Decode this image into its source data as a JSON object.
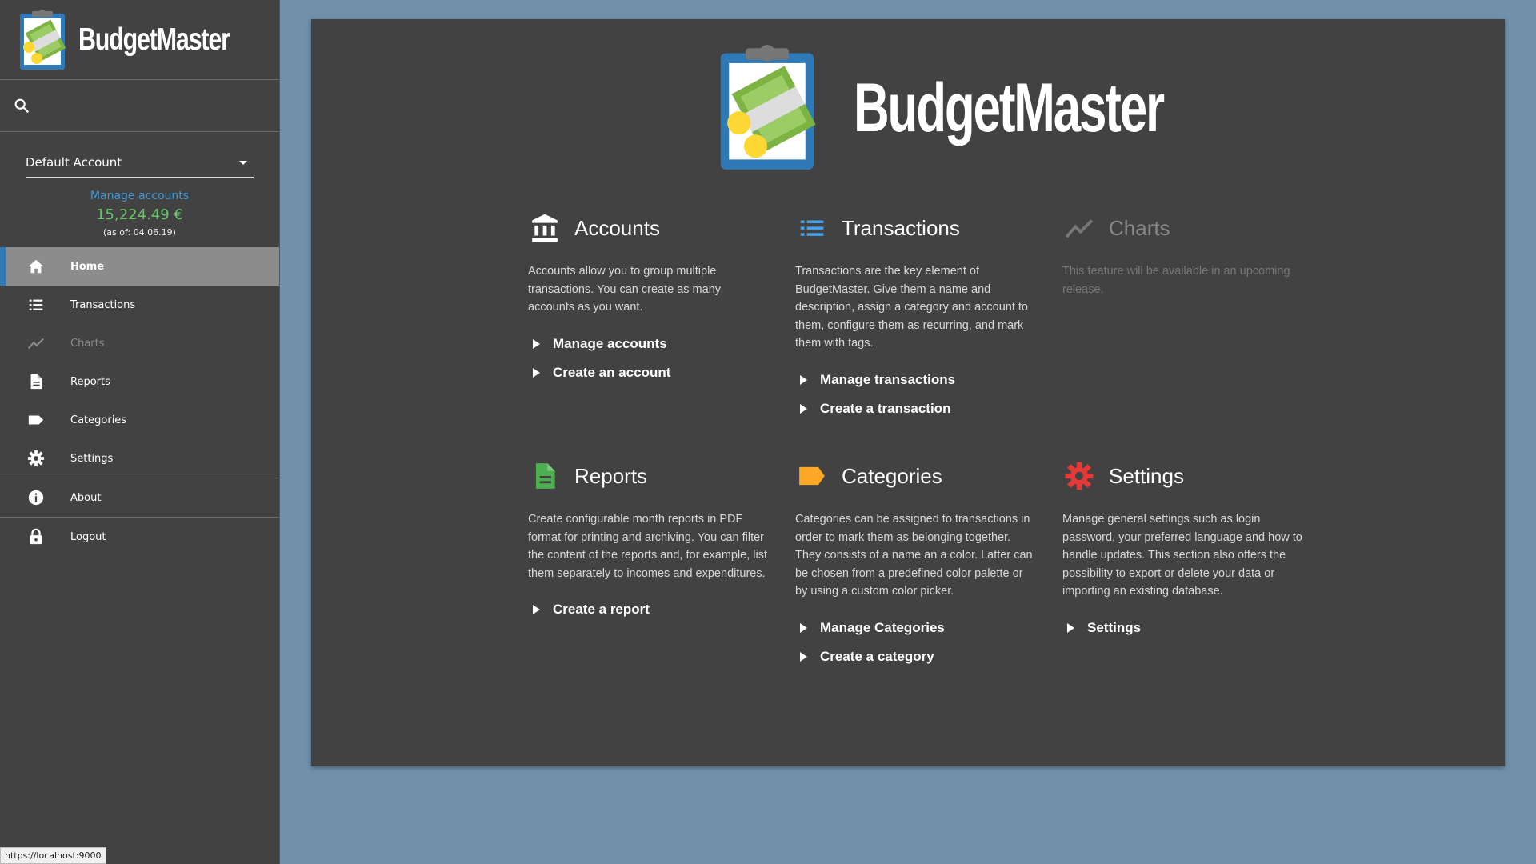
{
  "app": {
    "name": "BudgetMaster"
  },
  "account": {
    "selected": "Default Account",
    "manage_label": "Manage accounts",
    "balance": "15,224.49 €",
    "as_of": "(as of: 04.06.19)"
  },
  "nav": {
    "items": [
      {
        "label": "Home",
        "icon": "home-icon",
        "active": true
      },
      {
        "label": "Transactions",
        "icon": "list-icon"
      },
      {
        "label": "Charts",
        "icon": "chart-icon",
        "disabled": true
      },
      {
        "label": "Reports",
        "icon": "document-icon"
      },
      {
        "label": "Categories",
        "icon": "label-icon"
      },
      {
        "label": "Settings",
        "icon": "gear-icon"
      },
      {
        "label": "About",
        "icon": "info-icon"
      },
      {
        "label": "Logout",
        "icon": "lock-icon"
      }
    ]
  },
  "status_url": "https://localhost:9000",
  "features": {
    "accounts": {
      "title": "Accounts",
      "description": "Accounts allow you to group multiple transactions. You can create as many accounts as you want.",
      "links": [
        "Manage accounts",
        "Create an account"
      ]
    },
    "transactions": {
      "title": "Transactions",
      "description": "Transactions are the key element of BudgetMaster. Give them a name and description, assign a category and account to them, configure them as recurring, and mark them with tags.",
      "links": [
        "Manage transactions",
        "Create a transaction"
      ]
    },
    "charts": {
      "title": "Charts",
      "description": "This feature will be available in an upcoming release."
    },
    "reports": {
      "title": "Reports",
      "description": "Create configurable month reports in PDF format for printing and archiving. You can filter the content of the reports and, for example, list them separately to incomes and expenditures.",
      "links": [
        "Create a report"
      ]
    },
    "categories": {
      "title": "Categories",
      "description": "Categories can be assigned to transactions in order to mark them as belonging together. They consists of a name an a color. Latter can be chosen from a predefined color palette or by using a custom color picker.",
      "links": [
        "Manage Categories",
        "Create a category"
      ]
    },
    "settings": {
      "title": "Settings",
      "description": "Manage general settings such as login password, your preferred language and how to handle updates. This section also offers the possibility to export or delete your data or importing an existing database.",
      "links": [
        "Settings"
      ]
    }
  },
  "colors": {
    "sidebar_bg": "#424242",
    "page_bg": "#7191aa",
    "accent_blue": "#2f79b6",
    "link_blue": "#3e9ad8",
    "balance_green": "#68c46a",
    "reports_green": "#4caf50",
    "categories_orange": "#ffa726",
    "settings_red": "#e53935",
    "transactions_blue": "#42a5f5"
  }
}
